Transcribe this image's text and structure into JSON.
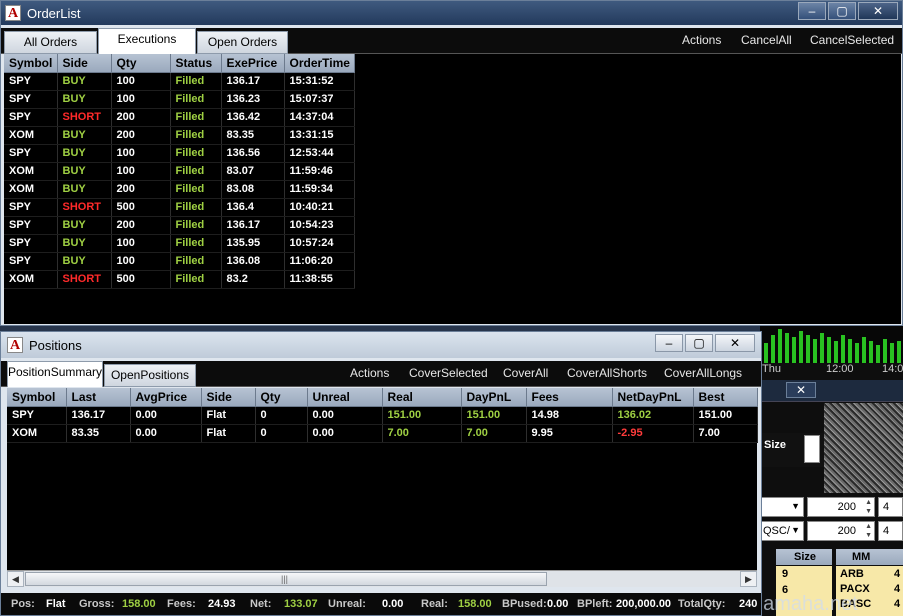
{
  "orderlist": {
    "title": "OrderList",
    "tabs": [
      "All Orders",
      "Executions",
      "Open Orders"
    ],
    "menu": [
      "Actions",
      "CancelAll",
      "CancelSelected"
    ],
    "columns": [
      "Symbol",
      "Side",
      "Qty",
      "Status",
      "ExePrice",
      "OrderTime"
    ],
    "rows": [
      [
        "SPY",
        "BUY",
        "100",
        "Filled",
        "136.17",
        "15:31:52"
      ],
      [
        "SPY",
        "BUY",
        "100",
        "Filled",
        "136.23",
        "15:07:37"
      ],
      [
        "SPY",
        "SHORT",
        "200",
        "Filled",
        "136.42",
        "14:37:04"
      ],
      [
        "XOM",
        "BUY",
        "200",
        "Filled",
        "83.35",
        "13:31:15"
      ],
      [
        "SPY",
        "BUY",
        "100",
        "Filled",
        "136.56",
        "12:53:44"
      ],
      [
        "XOM",
        "BUY",
        "100",
        "Filled",
        "83.07",
        "11:59:46"
      ],
      [
        "XOM",
        "BUY",
        "200",
        "Filled",
        "83.08",
        "11:59:34"
      ],
      [
        "SPY",
        "SHORT",
        "500",
        "Filled",
        "136.4",
        "10:40:21"
      ],
      [
        "SPY",
        "BUY",
        "200",
        "Filled",
        "136.17",
        "10:54:23"
      ],
      [
        "SPY",
        "BUY",
        "100",
        "Filled",
        "135.95",
        "10:57:24"
      ],
      [
        "SPY",
        "BUY",
        "100",
        "Filled",
        "136.08",
        "11:06:20"
      ],
      [
        "XOM",
        "SHORT",
        "500",
        "Filled",
        "83.2",
        "11:38:55"
      ]
    ]
  },
  "positions": {
    "title": "Positions",
    "tabs": [
      "PositionSummary",
      "OpenPositions"
    ],
    "menu": [
      "Actions",
      "CoverSelected",
      "CoverAll",
      "CoverAllShorts",
      "CoverAllLongs"
    ],
    "columns": [
      "Symbol",
      "Last",
      "AvgPrice",
      "Side",
      "Qty",
      "Unreal",
      "Real",
      "DayPnL",
      "Fees",
      "NetDayPnL",
      "Best"
    ],
    "rows": [
      [
        "SPY",
        "136.17",
        "0.00",
        "Flat",
        "0",
        "0.00",
        "151.00",
        "151.00",
        "14.98",
        "136.02",
        "151.00"
      ],
      [
        "XOM",
        "83.35",
        "0.00",
        "Flat",
        "0",
        "0.00",
        "7.00",
        "7.00",
        "9.95",
        "-2.95",
        "7.00"
      ]
    ],
    "status": {
      "pos_label": "Pos:",
      "pos": "Flat",
      "gross_label": "Gross:",
      "gross": "158.00",
      "fees_label": "Fees:",
      "fees": "24.93",
      "net_label": "Net:",
      "net": "133.07",
      "unreal_label": "Unreal:",
      "unreal": "0.00",
      "real_label": "Real:",
      "real": "158.00",
      "bpused_label": "BPused:",
      "bpused": "0.00",
      "bpleft_label": "BPleft:",
      "bpleft": "200,000.00",
      "totalqty_label": "TotalQty:",
      "totalqty": "240"
    }
  },
  "background": {
    "thu": "Thu",
    "t1": "12:00",
    "t2": "14:0",
    "size_label": "Size",
    "spin1": "200",
    "spin2": "200",
    "spin_side1": "4",
    "spin_side2": "4",
    "route": "QSC/",
    "size_col": "Size",
    "mm_col": "MM",
    "sizes": [
      "9",
      "6"
    ],
    "mms": [
      "ARB",
      "PACX",
      "BASC"
    ],
    "mm_right": [
      "4",
      "4",
      "4"
    ],
    "watermark": "hamaha.net"
  },
  "colors": {
    "buy": "#9fd043",
    "short": "#ff2a2a",
    "header": "#a8b6c8"
  }
}
